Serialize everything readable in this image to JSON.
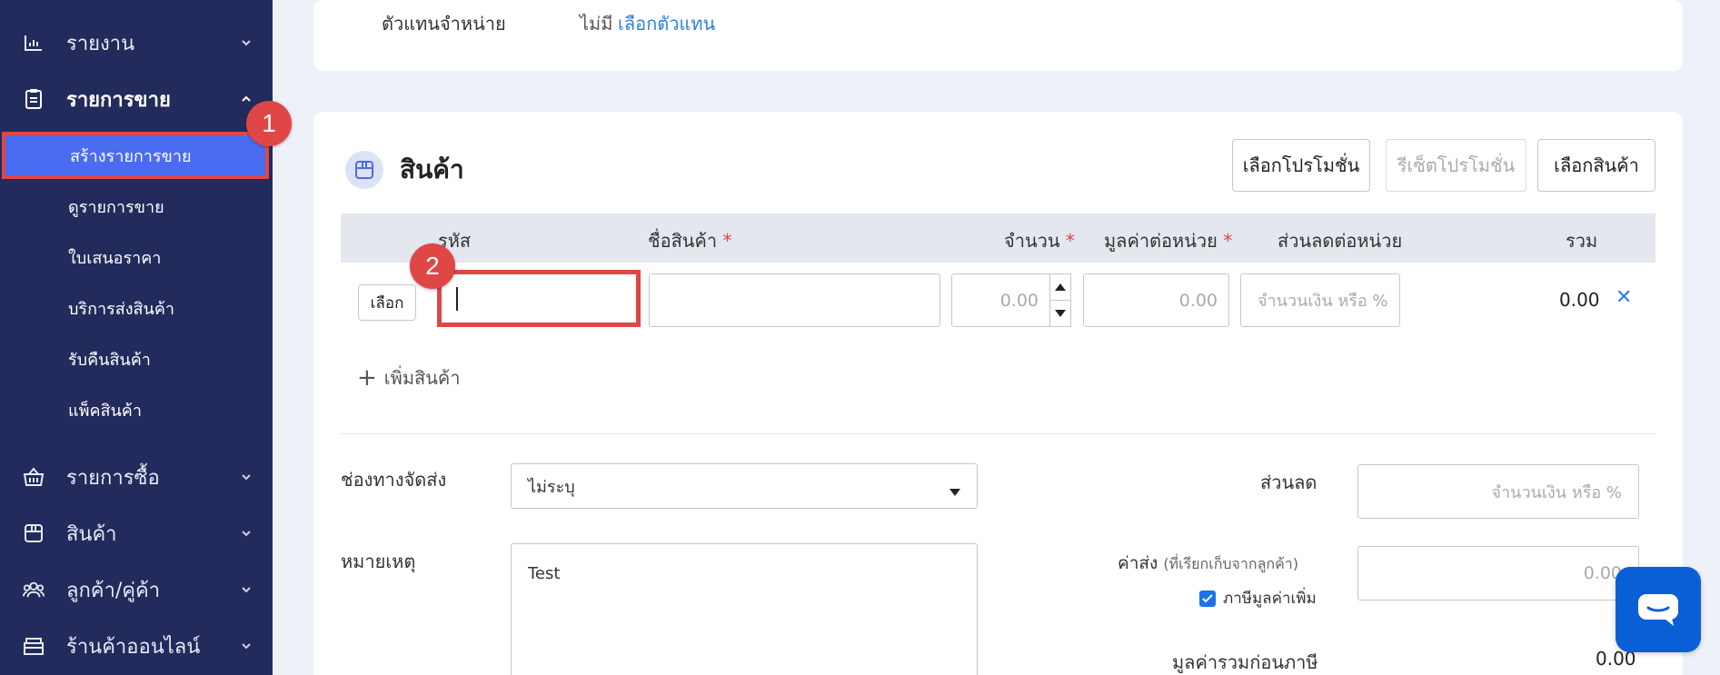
{
  "sidebar": {
    "reports": "รายงาน",
    "sales": "รายการขาย",
    "sales_sub": [
      "สร้างรายการขาย",
      "ดูรายการขาย",
      "ใบเสนอราคา",
      "บริการส่งสินค้า",
      "รับคืนสินค้า",
      "แพ็คสินค้า"
    ],
    "purchases": "รายการซื้อ",
    "products": "สินค้า",
    "contacts": "ลูกค้า/คู่ค้า",
    "online_store": "ร้านค้าออนไลน์"
  },
  "badges": {
    "one": "1",
    "two": "2"
  },
  "top_card": {
    "agent_label": "ตัวแทนจำหน่าย",
    "agent_value": "ไม่มี",
    "agent_link": "เลือกตัวแทน"
  },
  "products_card": {
    "title": "สินค้า",
    "buttons": {
      "select_promo": "เลือกโปรโมชั่น",
      "reset_promo": "รีเซ็ตโปรโมชั่น",
      "select_product": "เลือกสินค้า"
    },
    "columns": {
      "code": "รหัส",
      "name": "ชื่อสินค้า",
      "qty": "จำนวน",
      "unit_price": "มูลค่าต่อหน่วย",
      "discount": "ส่วนลดต่อหน่วย",
      "total": "รวม"
    },
    "row": {
      "select_btn": "เลือก",
      "qty_placeholder": "0.00",
      "price_placeholder": "0.00",
      "discount_placeholder": "จำนวนเงิน หรือ %",
      "total": "0.00"
    },
    "add_product": "เพิ่มสินค้า",
    "shipping_label": "ช่องทางจัดส่ง",
    "shipping_value": "ไม่ระบุ",
    "discount_label": "ส่วนลด",
    "discount_placeholder": "จำนวนเงิน หรือ %",
    "note_label": "หมายเหตุ",
    "note_value": "Test",
    "shipping_fee_label": "ค่าส่ง",
    "shipping_fee_hint": "(ที่เรียกเก็บจากลูกค้า)",
    "shipping_fee_placeholder": "0.00",
    "vat_label": "ภาษีมูลค่าเพิ่ม",
    "subtotal_label": "มูลค่ารวมก่อนภาษี",
    "subtotal_value": "0.00"
  },
  "colors": {
    "sidebar": "#232b5c",
    "selected": "#4a6cf0",
    "highlight": "#e04646",
    "link": "#2f7fe0",
    "chat": "#0a5fd6"
  }
}
